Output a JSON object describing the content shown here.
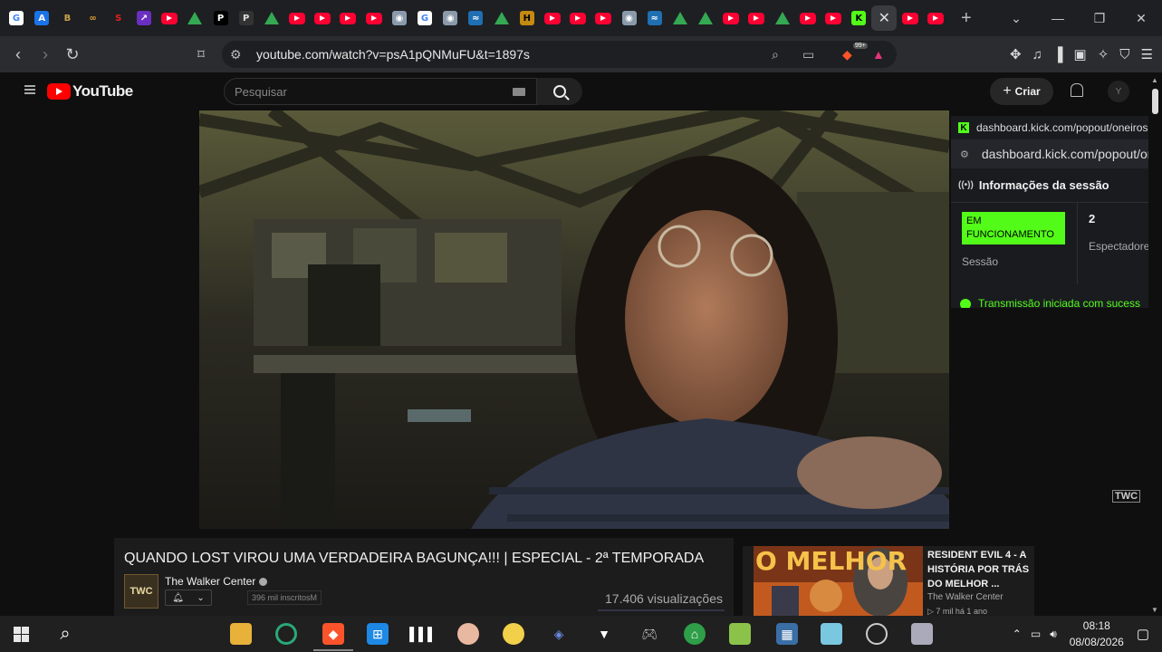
{
  "browser": {
    "tabs": [
      {
        "icon": "google-icon",
        "color": "#ffffff",
        "glyph": "G",
        "fg": "#4285f4"
      },
      {
        "icon": "app-icon",
        "color": "#1a73e8",
        "glyph": "A",
        "fg": "#fff"
      },
      {
        "icon": "b-icon",
        "color": "#1e1f22",
        "glyph": "B",
        "fg": "#c8a24a"
      },
      {
        "icon": "link-icon",
        "color": "#1e1f22",
        "glyph": "∞",
        "fg": "#e0a030"
      },
      {
        "icon": "s-icon",
        "color": "#1e1f22",
        "glyph": "S",
        "fg": "#e02020"
      },
      {
        "icon": "purple-icon",
        "color": "#6a2fc0",
        "glyph": "↗",
        "fg": "#fff"
      },
      {
        "icon": "youtube-icon",
        "kind": "yt"
      },
      {
        "icon": "drive-icon",
        "kind": "drive"
      },
      {
        "icon": "p-icon",
        "color": "#000000",
        "glyph": "P",
        "fg": "#fff"
      },
      {
        "icon": "pnm-icon",
        "color": "#333333",
        "glyph": "P",
        "fg": "#ddd"
      },
      {
        "icon": "drive-icon",
        "kind": "drive"
      },
      {
        "icon": "youtube-icon",
        "kind": "yt"
      },
      {
        "icon": "youtube-icon",
        "kind": "yt"
      },
      {
        "icon": "youtube-icon",
        "kind": "yt"
      },
      {
        "icon": "youtube-icon",
        "kind": "yt"
      },
      {
        "icon": "cat-icon",
        "color": "#8a9aaa",
        "glyph": "◉",
        "fg": "#fff"
      },
      {
        "icon": "google-icon",
        "color": "#ffffff",
        "glyph": "G",
        "fg": "#4285f4"
      },
      {
        "icon": "cat-icon",
        "color": "#8a9aaa",
        "glyph": "◉",
        "fg": "#fff"
      },
      {
        "icon": "site-icon",
        "color": "#1f6fb2",
        "glyph": "≈",
        "fg": "#fff"
      },
      {
        "icon": "drive-icon",
        "kind": "drive"
      },
      {
        "icon": "hd-icon",
        "color": "#c58a10",
        "glyph": "H",
        "fg": "#000"
      },
      {
        "icon": "youtube-icon",
        "kind": "yt"
      },
      {
        "icon": "youtube-icon",
        "kind": "yt"
      },
      {
        "icon": "youtube-icon",
        "kind": "yt"
      },
      {
        "icon": "cat-icon",
        "color": "#8a9aaa",
        "glyph": "◉",
        "fg": "#fff"
      },
      {
        "icon": "site-icon",
        "color": "#1f6fb2",
        "glyph": "≈",
        "fg": "#fff"
      },
      {
        "icon": "drive-icon",
        "kind": "drive"
      },
      {
        "icon": "drive-icon",
        "kind": "drive"
      },
      {
        "icon": "youtube-icon",
        "kind": "yt"
      },
      {
        "icon": "youtube-icon",
        "kind": "yt"
      },
      {
        "icon": "drive-icon",
        "kind": "drive"
      },
      {
        "icon": "youtube-icon",
        "kind": "yt"
      },
      {
        "icon": "youtube-icon",
        "kind": "yt"
      },
      {
        "icon": "kick-icon",
        "color": "#53fc18",
        "glyph": "K",
        "fg": "#000"
      },
      {
        "icon": "close-icon",
        "kind": "close"
      },
      {
        "icon": "youtube-icon",
        "kind": "yt"
      },
      {
        "icon": "youtube-icon",
        "kind": "yt"
      }
    ],
    "new_tab_label": "+",
    "url": "youtube.com/watch?v=psA1pQNMuFU&t=1897s",
    "shield_badge": "99+"
  },
  "youtube": {
    "logo_text": "YouTube",
    "search_placeholder": "Pesquisar",
    "create_label": "Criar",
    "avatar_text": "Y"
  },
  "video": {
    "watermark": "TWC",
    "title": "QUANDO LOST VIROU UMA VERDADEIRA BAGUNÇA!!! | ESPECIAL - 2ª TEMPORADA",
    "channel": "The Walker Center",
    "channel_avatar": "TWC",
    "subscribers": "396 mil inscritosM",
    "views": "17.406 visualizações"
  },
  "popout": {
    "title_url": "dashboard.kick.com/popout/oneiros-fo",
    "address_url": "dashboard.kick.com/popout/on",
    "section_title": "Informações da sessão",
    "status_badge": "EM FUNCIONAMENTO",
    "session_label": "Sessão",
    "viewers_count": "2",
    "viewers_label": "Espectadore",
    "notice": "Transmissão iniciada com sucess"
  },
  "recommended": {
    "thumb_text": "O MELHOR",
    "title": "RESIDENT EVIL 4 - A HISTÓRIA POR TRÁS DO MELHOR ...",
    "channel": "The Walker Center",
    "meta": "▷ 7 mil  há 1 ano"
  },
  "taskbar": {
    "time": "08:18",
    "date": "08/08/2026"
  }
}
